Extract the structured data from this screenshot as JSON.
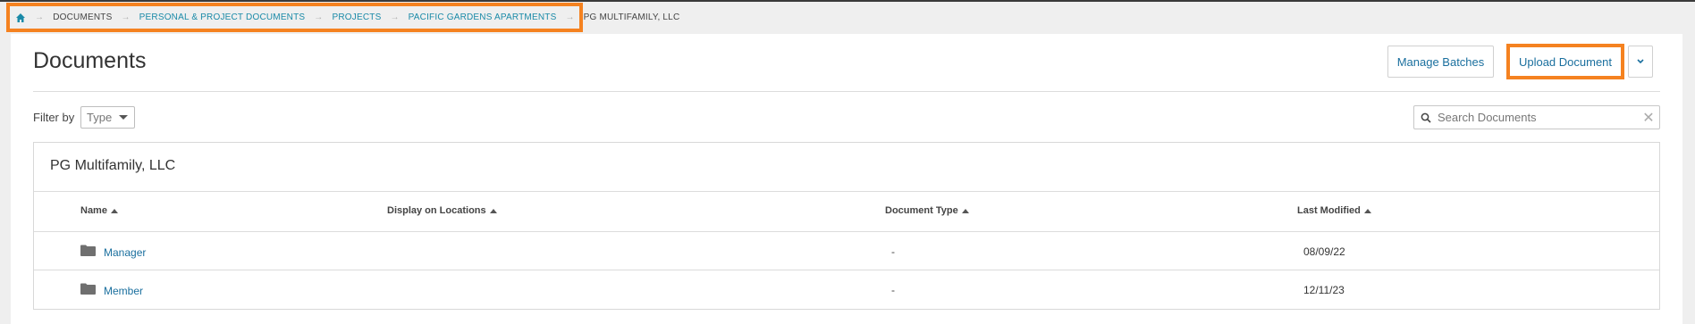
{
  "breadcrumb": {
    "home_icon": "home-icon",
    "items": [
      {
        "label": "DOCUMENTS"
      },
      {
        "label": "PERSONAL & PROJECT DOCUMENTS"
      },
      {
        "label": "PROJECTS"
      },
      {
        "label": "PACIFIC GARDENS APARTMENTS"
      },
      {
        "label": "PG MULTIFAMILY, LLC"
      }
    ]
  },
  "header": {
    "title": "Documents",
    "manage_batches": "Manage Batches",
    "upload_document": "Upload Document",
    "dropdown_icon": "chevron-down-icon"
  },
  "filter": {
    "label": "Filter by",
    "type_value": "Type"
  },
  "search": {
    "placeholder": "Search Documents",
    "value": ""
  },
  "panel": {
    "title": "PG Multifamily, LLC",
    "columns": [
      {
        "label": "Name"
      },
      {
        "label": "Display on Locations"
      },
      {
        "label": "Document Type"
      },
      {
        "label": "Last Modified"
      }
    ],
    "rows": [
      {
        "name": "Manager",
        "display_on_locations": "",
        "document_type": "-",
        "last_modified": "08/09/22"
      },
      {
        "name": "Member",
        "display_on_locations": "",
        "document_type": "-",
        "last_modified": "12/11/23"
      }
    ]
  },
  "colors": {
    "accent": "#1a8aa8",
    "highlight": "#f58220",
    "link": "#1a6f9e"
  }
}
